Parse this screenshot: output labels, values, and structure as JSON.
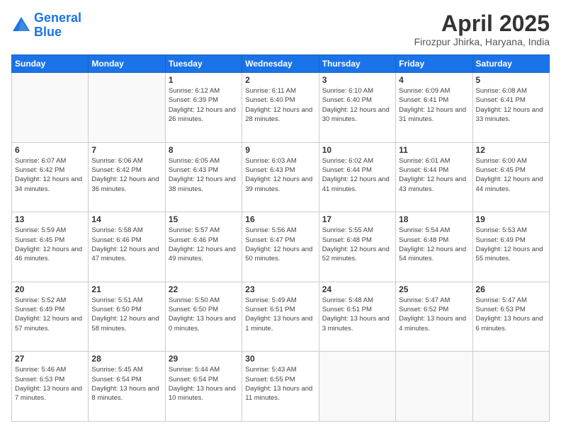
{
  "header": {
    "logo_line1": "General",
    "logo_line2": "Blue",
    "title": "April 2025",
    "location": "Firozpur Jhirka, Haryana, India"
  },
  "days_of_week": [
    "Sunday",
    "Monday",
    "Tuesday",
    "Wednesday",
    "Thursday",
    "Friday",
    "Saturday"
  ],
  "weeks": [
    [
      {
        "day": "",
        "sunrise": "",
        "sunset": "",
        "daylight": ""
      },
      {
        "day": "",
        "sunrise": "",
        "sunset": "",
        "daylight": ""
      },
      {
        "day": "1",
        "sunrise": "Sunrise: 6:12 AM",
        "sunset": "Sunset: 6:39 PM",
        "daylight": "Daylight: 12 hours and 26 minutes."
      },
      {
        "day": "2",
        "sunrise": "Sunrise: 6:11 AM",
        "sunset": "Sunset: 6:40 PM",
        "daylight": "Daylight: 12 hours and 28 minutes."
      },
      {
        "day": "3",
        "sunrise": "Sunrise: 6:10 AM",
        "sunset": "Sunset: 6:40 PM",
        "daylight": "Daylight: 12 hours and 30 minutes."
      },
      {
        "day": "4",
        "sunrise": "Sunrise: 6:09 AM",
        "sunset": "Sunset: 6:41 PM",
        "daylight": "Daylight: 12 hours and 31 minutes."
      },
      {
        "day": "5",
        "sunrise": "Sunrise: 6:08 AM",
        "sunset": "Sunset: 6:41 PM",
        "daylight": "Daylight: 12 hours and 33 minutes."
      }
    ],
    [
      {
        "day": "6",
        "sunrise": "Sunrise: 6:07 AM",
        "sunset": "Sunset: 6:42 PM",
        "daylight": "Daylight: 12 hours and 34 minutes."
      },
      {
        "day": "7",
        "sunrise": "Sunrise: 6:06 AM",
        "sunset": "Sunset: 6:42 PM",
        "daylight": "Daylight: 12 hours and 36 minutes."
      },
      {
        "day": "8",
        "sunrise": "Sunrise: 6:05 AM",
        "sunset": "Sunset: 6:43 PM",
        "daylight": "Daylight: 12 hours and 38 minutes."
      },
      {
        "day": "9",
        "sunrise": "Sunrise: 6:03 AM",
        "sunset": "Sunset: 6:43 PM",
        "daylight": "Daylight: 12 hours and 39 minutes."
      },
      {
        "day": "10",
        "sunrise": "Sunrise: 6:02 AM",
        "sunset": "Sunset: 6:44 PM",
        "daylight": "Daylight: 12 hours and 41 minutes."
      },
      {
        "day": "11",
        "sunrise": "Sunrise: 6:01 AM",
        "sunset": "Sunset: 6:44 PM",
        "daylight": "Daylight: 12 hours and 43 minutes."
      },
      {
        "day": "12",
        "sunrise": "Sunrise: 6:00 AM",
        "sunset": "Sunset: 6:45 PM",
        "daylight": "Daylight: 12 hours and 44 minutes."
      }
    ],
    [
      {
        "day": "13",
        "sunrise": "Sunrise: 5:59 AM",
        "sunset": "Sunset: 6:45 PM",
        "daylight": "Daylight: 12 hours and 46 minutes."
      },
      {
        "day": "14",
        "sunrise": "Sunrise: 5:58 AM",
        "sunset": "Sunset: 6:46 PM",
        "daylight": "Daylight: 12 hours and 47 minutes."
      },
      {
        "day": "15",
        "sunrise": "Sunrise: 5:57 AM",
        "sunset": "Sunset: 6:46 PM",
        "daylight": "Daylight: 12 hours and 49 minutes."
      },
      {
        "day": "16",
        "sunrise": "Sunrise: 5:56 AM",
        "sunset": "Sunset: 6:47 PM",
        "daylight": "Daylight: 12 hours and 50 minutes."
      },
      {
        "day": "17",
        "sunrise": "Sunrise: 5:55 AM",
        "sunset": "Sunset: 6:48 PM",
        "daylight": "Daylight: 12 hours and 52 minutes."
      },
      {
        "day": "18",
        "sunrise": "Sunrise: 5:54 AM",
        "sunset": "Sunset: 6:48 PM",
        "daylight": "Daylight: 12 hours and 54 minutes."
      },
      {
        "day": "19",
        "sunrise": "Sunrise: 5:53 AM",
        "sunset": "Sunset: 6:49 PM",
        "daylight": "Daylight: 12 hours and 55 minutes."
      }
    ],
    [
      {
        "day": "20",
        "sunrise": "Sunrise: 5:52 AM",
        "sunset": "Sunset: 6:49 PM",
        "daylight": "Daylight: 12 hours and 57 minutes."
      },
      {
        "day": "21",
        "sunrise": "Sunrise: 5:51 AM",
        "sunset": "Sunset: 6:50 PM",
        "daylight": "Daylight: 12 hours and 58 minutes."
      },
      {
        "day": "22",
        "sunrise": "Sunrise: 5:50 AM",
        "sunset": "Sunset: 6:50 PM",
        "daylight": "Daylight: 13 hours and 0 minutes."
      },
      {
        "day": "23",
        "sunrise": "Sunrise: 5:49 AM",
        "sunset": "Sunset: 6:51 PM",
        "daylight": "Daylight: 13 hours and 1 minute."
      },
      {
        "day": "24",
        "sunrise": "Sunrise: 5:48 AM",
        "sunset": "Sunset: 6:51 PM",
        "daylight": "Daylight: 13 hours and 3 minutes."
      },
      {
        "day": "25",
        "sunrise": "Sunrise: 5:47 AM",
        "sunset": "Sunset: 6:52 PM",
        "daylight": "Daylight: 13 hours and 4 minutes."
      },
      {
        "day": "26",
        "sunrise": "Sunrise: 5:47 AM",
        "sunset": "Sunset: 6:53 PM",
        "daylight": "Daylight: 13 hours and 6 minutes."
      }
    ],
    [
      {
        "day": "27",
        "sunrise": "Sunrise: 5:46 AM",
        "sunset": "Sunset: 6:53 PM",
        "daylight": "Daylight: 13 hours and 7 minutes."
      },
      {
        "day": "28",
        "sunrise": "Sunrise: 5:45 AM",
        "sunset": "Sunset: 6:54 PM",
        "daylight": "Daylight: 13 hours and 8 minutes."
      },
      {
        "day": "29",
        "sunrise": "Sunrise: 5:44 AM",
        "sunset": "Sunset: 6:54 PM",
        "daylight": "Daylight: 13 hours and 10 minutes."
      },
      {
        "day": "30",
        "sunrise": "Sunrise: 5:43 AM",
        "sunset": "Sunset: 6:55 PM",
        "daylight": "Daylight: 13 hours and 11 minutes."
      },
      {
        "day": "",
        "sunrise": "",
        "sunset": "",
        "daylight": ""
      },
      {
        "day": "",
        "sunrise": "",
        "sunset": "",
        "daylight": ""
      },
      {
        "day": "",
        "sunrise": "",
        "sunset": "",
        "daylight": ""
      }
    ]
  ]
}
